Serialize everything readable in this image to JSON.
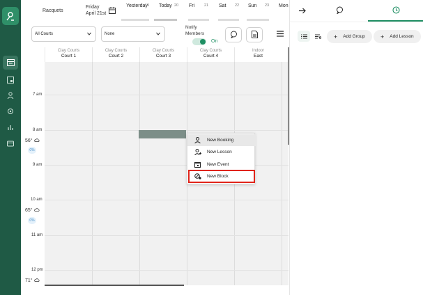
{
  "header": {
    "section": "Racquets",
    "weekday": "Friday",
    "date": "April 21st",
    "days": [
      {
        "label": "Yesterday",
        "num": "19"
      },
      {
        "label": "Today",
        "num": "20"
      },
      {
        "label": "Fri",
        "num": "21"
      },
      {
        "label": "Sat",
        "num": "22"
      },
      {
        "label": "Sun",
        "num": "23"
      },
      {
        "label": "Mon",
        "num": ""
      }
    ]
  },
  "filters": {
    "courts": "All Courts",
    "second": "None",
    "notify_line1": "Notify",
    "notify_line2": "Members",
    "toggle_state": "On"
  },
  "columns": [
    {
      "group": "Clay Courts",
      "name": "Court 1"
    },
    {
      "group": "Clay Courts",
      "name": "Court 2"
    },
    {
      "group": "Clay Courts",
      "name": "Court 3"
    },
    {
      "group": "Clay Courts",
      "name": "Court 4"
    },
    {
      "group": "Indoor",
      "name": "East"
    }
  ],
  "times": [
    "7 am",
    "8 am",
    "9 am",
    "10 am",
    "11 am",
    "12 pm"
  ],
  "weather": [
    {
      "temp": "56°",
      "precip": "0%"
    },
    {
      "temp": "65°",
      "precip": "0%"
    },
    {
      "temp": "71°",
      "precip": ""
    }
  ],
  "context_menu": {
    "items": [
      "New Booking",
      "New Lesson",
      "New Event",
      "New Block"
    ]
  },
  "right_panel": {
    "add_group": "Add Group",
    "add_lesson": "Add Lesson"
  },
  "colors": {
    "rail": "#1f5a45",
    "accent": "#1f8f63",
    "highlight_box": "#e0241a"
  }
}
